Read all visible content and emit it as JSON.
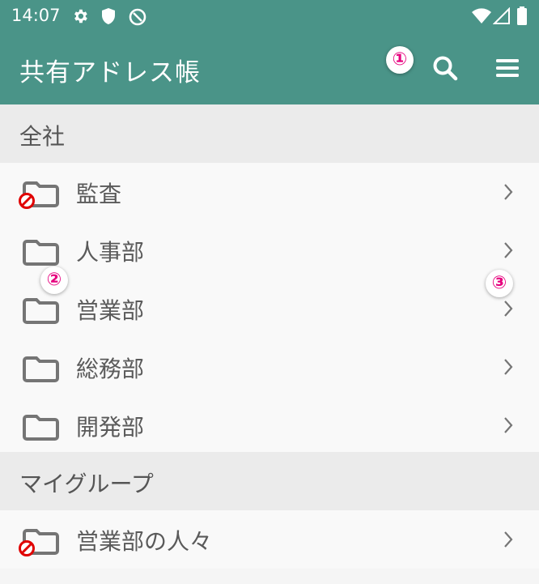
{
  "status": {
    "time": "14:07"
  },
  "appbar": {
    "title": "共有アドレス帳"
  },
  "sections": [
    {
      "label": "全社",
      "items": [
        {
          "label": "監査",
          "restricted": true
        },
        {
          "label": "人事部",
          "restricted": false
        },
        {
          "label": "営業部",
          "restricted": false
        },
        {
          "label": "総務部",
          "restricted": false
        },
        {
          "label": "開発部",
          "restricted": false
        }
      ]
    },
    {
      "label": "マイグループ",
      "items": [
        {
          "label": "営業部の人々",
          "restricted": true
        }
      ]
    }
  ],
  "annotations": [
    "①",
    "②",
    "③"
  ],
  "colors": {
    "appbar": "#4a9488",
    "badge": "#e6007e",
    "prohibited": "#e00000"
  }
}
